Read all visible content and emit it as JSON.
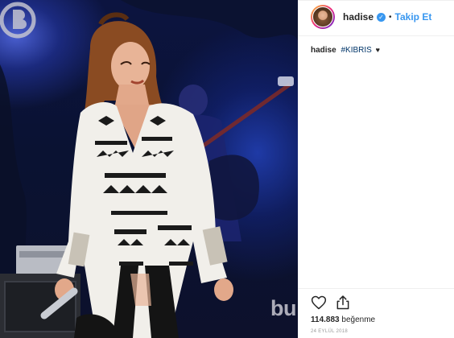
{
  "post": {
    "username": "hadise",
    "verified_icon": "verified-badge-icon",
    "separator": "•",
    "follow_label": "Takip Et",
    "caption": {
      "username": "hadise",
      "hashtag": "#KIBRIS",
      "emoji": "♥"
    },
    "likes": {
      "count": "114.883",
      "label": "beğenme"
    },
    "date": "24 EYLÜL 2018",
    "actions": [
      "heart-icon",
      "share-icon"
    ]
  },
  "watermark": {
    "text": "bu"
  },
  "colors": {
    "link": "#3897f0",
    "hashtag": "#003569",
    "text": "#262626",
    "muted": "#999999",
    "stage_blue": "#1f3aa6"
  }
}
